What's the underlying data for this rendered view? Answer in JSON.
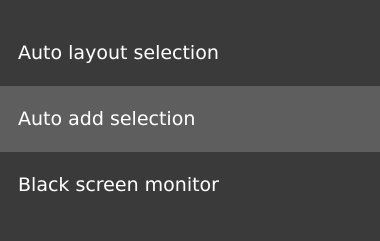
{
  "menu": {
    "items": [
      {
        "label": "Auto layout selection",
        "highlighted": false
      },
      {
        "label": "Auto add selection",
        "highlighted": true
      },
      {
        "label": "Black screen monitor",
        "highlighted": false
      }
    ]
  },
  "colors": {
    "menu_background": "#3a3a3a",
    "highlight_background": "#5e5e5e",
    "text": "#ffffff"
  }
}
